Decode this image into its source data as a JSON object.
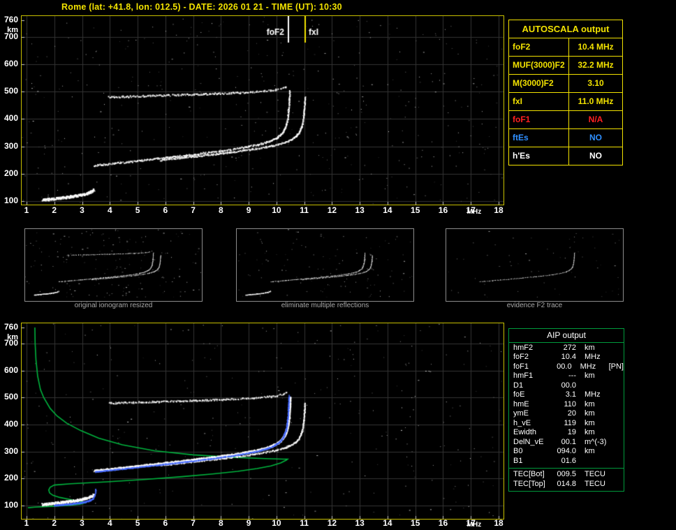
{
  "title": "Rome (lat: +41.8, lon: 012.5) - DATE: 2026 01 21 - TIME (UT): 10:30",
  "colors": {
    "yellow": "#f2e200",
    "plot_border": "#c8c000",
    "grid": "#343434",
    "white": "#ffffff",
    "green": "#00b43e",
    "green_border": "#009a3c",
    "blue": "#4569ff",
    "red": "#ff2020",
    "ftes_blue": "#2f8fff",
    "caption_gray": "#a8a8a8",
    "thumb_border": "#8c8c8c"
  },
  "top_plot": {
    "y_unit": "km",
    "x_unit": "MHz",
    "y_ticks": [
      760,
      700,
      600,
      500,
      400,
      300,
      200,
      100
    ],
    "x_ticks": [
      1,
      2,
      3,
      4,
      5,
      6,
      7,
      8,
      9,
      10,
      11,
      12,
      13,
      14,
      15,
      16,
      17,
      18
    ]
  },
  "bottom_plot": {
    "y_unit": "km",
    "x_unit": "MHz",
    "y_ticks": [
      760,
      700,
      600,
      500,
      400,
      300,
      200,
      100
    ],
    "x_ticks": [
      1,
      2,
      3,
      4,
      5,
      6,
      7,
      8,
      9,
      10,
      11,
      12,
      13,
      14,
      15,
      16,
      17,
      18
    ]
  },
  "autoscala_table": {
    "title": "AUTOSCALA output",
    "rows": [
      {
        "param": "foF2",
        "value": "10.4 MHz",
        "color": "#f2e200"
      },
      {
        "param": "MUF(3000)F2",
        "value": "32.2 MHz",
        "color": "#f2e200"
      },
      {
        "param": "M(3000)F2",
        "value": "3.10",
        "color": "#f2e200"
      },
      {
        "param": "fxI",
        "value": "11.0 MHz",
        "color": "#f2e200"
      },
      {
        "param": "foF1",
        "value": "N/A",
        "color": "#ff2020"
      },
      {
        "param": "ftEs",
        "value": "NO",
        "color": "#2f8fff"
      },
      {
        "param": "h'Es",
        "value": "NO",
        "color": "#ffffff"
      }
    ]
  },
  "thumbnails": [
    {
      "caption": "original ionogram resized"
    },
    {
      "caption": "eliminate multiple reflections"
    },
    {
      "caption": "evidence F2 trace"
    }
  ],
  "aip_table": {
    "title": "AIP output",
    "rows": [
      {
        "param": "hmF2",
        "value": "272",
        "unit": "km"
      },
      {
        "param": "foF2",
        "value": "10.4",
        "unit": "MHz"
      },
      {
        "param": "foF1",
        "value": "00.0",
        "unit": "MHz",
        "extra": "[PN]"
      },
      {
        "param": "hmF1",
        "value": "---",
        "unit": "km"
      },
      {
        "param": "D1",
        "value": "00.0",
        "unit": ""
      },
      {
        "param": "foE",
        "value": "3.1",
        "unit": "MHz"
      },
      {
        "param": "hmE",
        "value": "110",
        "unit": "km"
      },
      {
        "param": "ymE",
        "value": "20",
        "unit": "km"
      },
      {
        "param": "h_vE",
        "value": "119",
        "unit": "km"
      },
      {
        "param": "Ewidth",
        "value": "19",
        "unit": "km"
      },
      {
        "param": "DelN_vE",
        "value": "00.1",
        "unit": "m^(-3)"
      },
      {
        "param": "B0",
        "value": "094.0",
        "unit": "km"
      },
      {
        "param": "B1",
        "value": "01.6",
        "unit": ""
      }
    ],
    "tec_rows": [
      {
        "param": "TEC[Bot]",
        "value": "009.5",
        "unit": "TECU"
      },
      {
        "param": "TEC[Top]",
        "value": "014.8",
        "unit": "TECU"
      }
    ]
  },
  "chart_data": {
    "type": "scatter",
    "description": "Ionogram: virtual height (km) vs sounding frequency (MHz), with AIP fitted trace (blue) and electron density profile (green)",
    "x_range": [
      1,
      18
    ],
    "y_range": [
      100,
      760
    ],
    "scaled_values": {
      "foF2_MHz": 10.4,
      "fxI_MHz": 11.0,
      "MUF3000F2_MHz": 32.2,
      "M3000F2": 3.1,
      "hmF2_km": 272,
      "foE_MHz": 3.1,
      "hmE_km": 110,
      "B0_km": 94.0,
      "B1": 1.6,
      "TEC_bot_TECU": 9.5,
      "TEC_top_TECU": 14.8
    },
    "markers": [
      {
        "label": "foF2",
        "f": 10.4,
        "line": "#ffffff",
        "side": "left"
      },
      {
        "label": "fxI",
        "f": 11.0,
        "line": "#f2e200",
        "side": "right"
      }
    ],
    "traces": {
      "E": {
        "fb": 1.55,
        "h0": 96,
        "slope": 8,
        "a": 14,
        "p": 0.5,
        "fc": 3.6,
        "f1": 1.55,
        "f2": 3.42,
        "hmax": 172,
        "jh": 9,
        "n": 300
      },
      "F2o": {
        "fb": 3.4,
        "h0": 222,
        "slope": 10,
        "a": 30,
        "p": 0.6,
        "fc": 10.5,
        "f1": 3.42,
        "f2": 10.47,
        "hmax": 505,
        "jh": 6,
        "n": 340,
        "bFrom": 315
      },
      "F2x": {
        "fb": 3.4,
        "h0": 218,
        "slope": 9.5,
        "a": 28,
        "p": 0.6,
        "fc": 11.05,
        "f1": 5.8,
        "f2": 11.02,
        "hmax": 482,
        "jh": 5,
        "n": 240,
        "bFrom": 312
      },
      "mult": {
        "fb": 4.0,
        "h0": 478,
        "slope": 2.5,
        "a": 12,
        "p": 0.6,
        "fc": 10.6,
        "f1": 3.95,
        "f2": 10.42,
        "hmax": 522,
        "jh": 6,
        "n": 230
      }
    },
    "fit_blue": {
      "F": {
        "fb": 3.4,
        "h0": 217,
        "slope": 10,
        "a": 30,
        "p": 0.6,
        "fc": 10.47,
        "f1": 3.45,
        "f2": 10.44,
        "hmax": 510,
        "jh": 2,
        "n": 330,
        "bFrom": 300
      },
      "E": {
        "fb": 2.0,
        "h0": 95,
        "slope": 6,
        "a": 9,
        "p": 0.5,
        "fc": 3.5,
        "f1": 2.0,
        "f2": 3.38,
        "hmax": 162,
        "jh": 3,
        "n": 160,
        "bFrom": 126
      }
    },
    "profile_green": [
      [
        1.3,
        760
      ],
      [
        1.31,
        700
      ],
      [
        1.34,
        640
      ],
      [
        1.4,
        580
      ],
      [
        1.5,
        530
      ],
      [
        1.62,
        500
      ],
      [
        1.85,
        460
      ],
      [
        2.1,
        432
      ],
      [
        2.45,
        405
      ],
      [
        2.95,
        378
      ],
      [
        3.6,
        350
      ],
      [
        4.45,
        325
      ],
      [
        5.6,
        303
      ],
      [
        7.0,
        288
      ],
      [
        8.4,
        279
      ],
      [
        9.6,
        274
      ],
      [
        10.25,
        272
      ],
      [
        10.4,
        272
      ],
      [
        10.35,
        268
      ],
      [
        10.15,
        258
      ],
      [
        9.8,
        247
      ],
      [
        9.3,
        237
      ],
      [
        8.6,
        227
      ],
      [
        7.7,
        217
      ],
      [
        6.6,
        207
      ],
      [
        5.3,
        197
      ],
      [
        3.9,
        188
      ],
      [
        2.6,
        181
      ],
      [
        2.0,
        176
      ],
      [
        1.85,
        168
      ],
      [
        1.8,
        158
      ],
      [
        1.83,
        147
      ],
      [
        1.95,
        138
      ],
      [
        2.2,
        130
      ],
      [
        2.6,
        122
      ],
      [
        2.95,
        115
      ],
      [
        3.1,
        110
      ],
      [
        2.95,
        105
      ],
      [
        2.55,
        101
      ],
      [
        1.9,
        97
      ],
      [
        1.3,
        94
      ],
      [
        1.05,
        92
      ]
    ]
  }
}
